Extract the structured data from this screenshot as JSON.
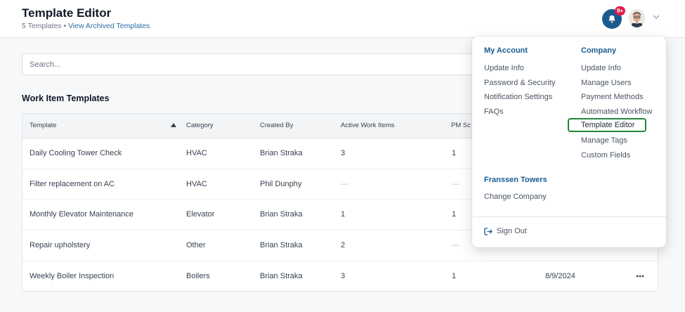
{
  "header": {
    "title": "Template Editor",
    "count": "5 Templates",
    "separator": "•",
    "archived_link": "View Archived Templates",
    "badge": "9+"
  },
  "search": {
    "placeholder": "Search..."
  },
  "section": {
    "title": "Work Item Templates"
  },
  "table": {
    "columns": [
      "Template",
      "Category",
      "Created By",
      "Active Work Items",
      "PM Sc"
    ],
    "rows": [
      {
        "template": "Daily Cooling Tower Check",
        "category": "HVAC",
        "created_by": "Brian Straka",
        "active": "3",
        "pm": "1",
        "date": ""
      },
      {
        "template": "Filter replacement on AC",
        "category": "HVAC",
        "created_by": "Phil Dunphy",
        "active": "—",
        "pm": "—",
        "date": ""
      },
      {
        "template": "Monthly Elevator Maintenance",
        "category": "Elevator",
        "created_by": "Brian Straka",
        "active": "1",
        "pm": "1",
        "date": ""
      },
      {
        "template": "Repair upholstery",
        "category": "Other",
        "created_by": "Brian Straka",
        "active": "2",
        "pm": "—",
        "date": ""
      },
      {
        "template": "Weekly Boiler Inspection",
        "category": "Boilers",
        "created_by": "Brian Straka",
        "active": "3",
        "pm": "1",
        "date": "8/9/2024"
      }
    ]
  },
  "menu": {
    "my_account": {
      "heading": "My Account",
      "items": [
        "Update Info",
        "Password & Security",
        "Notification Settings",
        "FAQs"
      ]
    },
    "company": {
      "heading": "Company",
      "items": [
        "Update Info",
        "Manage Users",
        "Payment Methods",
        "Automated Workflow",
        "Template Editor",
        "Manage Tags",
        "Custom Fields"
      ],
      "active_index": 4
    },
    "building": {
      "heading": "Franssen Towers",
      "items": [
        "Change Company"
      ]
    },
    "sign_out": "Sign Out"
  },
  "colors": {
    "accent": "#1a5b8f",
    "active_outline": "#22863a",
    "badge": "#e11d48"
  },
  "icons": [
    "bell-icon",
    "avatar",
    "chevron-down-icon",
    "sort-up-icon",
    "more-icon",
    "sign-out-icon"
  ]
}
